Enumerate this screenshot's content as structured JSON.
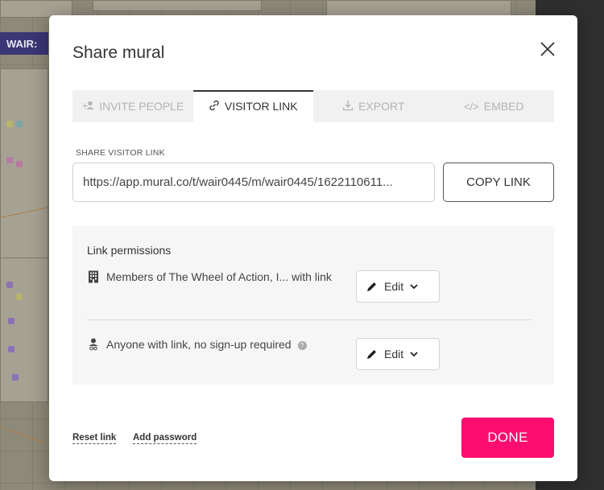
{
  "background": {
    "board_tag": "WAIR:"
  },
  "modal": {
    "title": "Share mural",
    "close_icon": "close-icon"
  },
  "tabs": [
    {
      "label": "INVITE PEOPLE",
      "icon": "add-user-icon",
      "active": false
    },
    {
      "label": "VISITOR LINK",
      "icon": "link-icon",
      "active": true
    },
    {
      "label": "EXPORT",
      "icon": "download-icon",
      "active": false
    },
    {
      "label": "EMBED",
      "icon": "code-icon",
      "active": false
    }
  ],
  "share_link": {
    "label": "SHARE VISITOR LINK",
    "value": "https://app.mural.co/t/wair0445/m/wair0445/1622110611...",
    "copy_label": "COPY LINK"
  },
  "permissions": {
    "title": "Link permissions",
    "rows": [
      {
        "icon": "building-icon",
        "text": "Members of The Wheel of Action, I... with link",
        "value": "Edit"
      },
      {
        "icon": "anonymous-user-icon",
        "text": "Anyone with link, no sign-up required",
        "value": "Edit",
        "help": "?"
      }
    ]
  },
  "footer": {
    "reset_label": "Reset link",
    "password_label": "Add password",
    "done_label": "DONE"
  },
  "colors": {
    "accent": "#fc0d6f",
    "board_tag": "#3b3675"
  }
}
